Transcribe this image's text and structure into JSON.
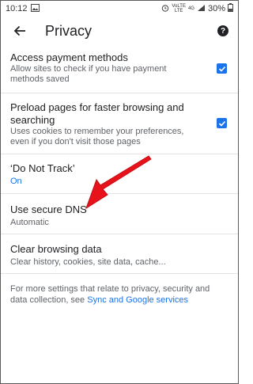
{
  "status_bar": {
    "time": "10:12",
    "volte": "VoLTE",
    "lte": "LTE",
    "network": "4G",
    "battery": "30%"
  },
  "app_bar": {
    "title": "Privacy"
  },
  "settings": [
    {
      "title": "Access payment methods",
      "subtitle": "Allow sites to check if you have payment methods saved",
      "checked": true
    },
    {
      "title": "Preload pages for faster browsing and searching",
      "subtitle": "Uses cookies to remember your preferences, even if you don't visit those pages",
      "checked": true
    },
    {
      "title": "‘Do Not Track’",
      "subtitle": "On"
    },
    {
      "title": "Use secure DNS",
      "subtitle": "Automatic"
    },
    {
      "title": "Clear browsing data",
      "subtitle": "Clear history, cookies, site data, cache..."
    }
  ],
  "footer": {
    "text": "For more settings that relate to privacy, security and data collection, see ",
    "link": "Sync and Google services"
  },
  "colors": {
    "accent": "#1a73e8",
    "annotation_arrow": "#e8121a"
  }
}
